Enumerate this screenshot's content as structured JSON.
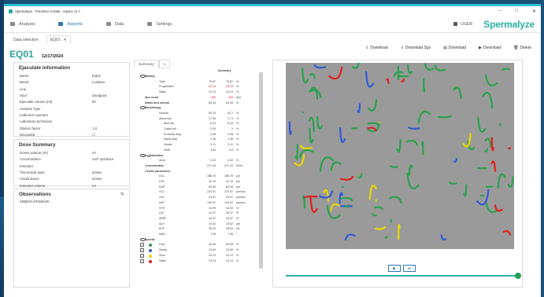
{
  "window": {
    "title": "Spermalyze - Precision Celular - equine v1.7",
    "min": "–",
    "max": "□",
    "close": "✕"
  },
  "nav": {
    "items": [
      {
        "label": "Analysis"
      },
      {
        "label": "Reports"
      },
      {
        "label": "Data"
      },
      {
        "label": "Settings"
      }
    ],
    "user": "USER",
    "brand": "Spermalyze"
  },
  "tabs": {
    "data_selection": "Data selection",
    "eq": "EQ01",
    "close": "✕"
  },
  "header": {
    "title": "EQ01",
    "date": "12/17/2024"
  },
  "actions": [
    {
      "label": "Download"
    },
    {
      "label": "Download Spz"
    },
    {
      "label": "Download"
    },
    {
      "label": "Download"
    },
    {
      "label": "Delete"
    }
  ],
  "ejaculate": {
    "title": "Ejaculate information",
    "rows": [
      {
        "k": "Name",
        "v": "EQ01"
      },
      {
        "k": "Breed",
        "v": "Lusitano"
      },
      {
        "k": "Line",
        "v": ""
      },
      {
        "k": "Stud",
        "v": "Zaragoza"
      },
      {
        "k": "Ejaculate volume (ml)",
        "v": "50"
      },
      {
        "k": "Analysis Type",
        "v": ""
      },
      {
        "k": "Collection operator",
        "v": ""
      },
      {
        "k": "Laboratory technician",
        "v": ""
      },
      {
        "k": "Dilution factor",
        "v": "1.8"
      },
      {
        "k": "Discarded",
        "v": "☐"
      }
    ]
  },
  "dose": {
    "title": "Dose Summary",
    "rows": [
      {
        "k": "Doses volume (ml)",
        "v": "ml"
      },
      {
        "k": "Concentration",
        "v": "x10⁶ spz/dose"
      },
      {
        "k": "Extender",
        "v": ""
      },
      {
        "k": "Theoretical dose",
        "v": "Doses"
      },
      {
        "k": "Actual doses",
        "v": "Doses"
      },
      {
        "k": "Extender volume",
        "v": "ml"
      }
    ]
  },
  "observations": {
    "title": "Observations",
    "text": "XIMEXX-STANDAR-"
  },
  "summary": {
    "tab1": "Summary",
    "tab2": "1",
    "col_summary": "Summary",
    "rows": [
      {
        "t": "sec",
        "l": "Motility"
      },
      {
        "t": "sub",
        "l": "Total",
        "a": "75.87",
        "b": "75.87",
        "u": "%"
      },
      {
        "t": "sub",
        "l": "Progressive",
        "a": "28.16",
        "b": "28.16",
        "u": "%",
        "red": true
      },
      {
        "t": "sub",
        "l": "Static",
        "a": "24.13",
        "b": "24.13",
        "u": "%"
      },
      {
        "t": "sec",
        "l": "Spz count",
        "a": "289",
        "b": "289",
        "u": "Spz",
        "red": true
      },
      {
        "t": "sec",
        "l": "Motile and normal",
        "a": "63.43",
        "b": "63.43",
        "u": "%"
      },
      {
        "t": "sec",
        "l": "Morphology"
      },
      {
        "t": "sub",
        "l": "Normal",
        "a": "82.70",
        "b": "82.7",
        "u": "%"
      },
      {
        "t": "sub",
        "l": "Abnormal",
        "a": "17.30",
        "b": "17.3",
        "u": "%"
      },
      {
        "t": "sub2",
        "l": "Bent tail",
        "a": "6.23",
        "b": "6.23",
        "u": "%"
      },
      {
        "t": "sub2",
        "l": "Coiled tail",
        "a": "0.00",
        "b": "0",
        "u": "%"
      },
      {
        "t": "sub2",
        "l": "Proximal drop",
        "a": "2.08",
        "b": "2.08",
        "u": "%"
      },
      {
        "t": "sub2",
        "l": "Distal drop",
        "a": "1.38",
        "b": "1.38",
        "u": "%"
      },
      {
        "t": "sub2",
        "l": "Heads",
        "a": "3.11",
        "b": "3.11",
        "u": "%"
      },
      {
        "t": "sub2",
        "l": "DMR",
        "a": "4.50",
        "b": "4.5",
        "u": "%"
      },
      {
        "t": "sec",
        "l": "Agglutination"
      },
      {
        "t": "sub",
        "l": "Area",
        "a": "0.42",
        "b": "0.42",
        "u": "%"
      },
      {
        "t": "sec",
        "l": "Concentration",
        "a": "271.44",
        "b": "271.44",
        "u": "M/ml"
      },
      {
        "t": "sec",
        "l": "Cinetic parameters"
      },
      {
        "t": "sub",
        "l": "DCL",
        "a": "186.78",
        "b": "186.78",
        "u": "µm"
      },
      {
        "t": "sub",
        "l": "DSL",
        "a": "42.19",
        "b": "42.19",
        "u": "µm"
      },
      {
        "t": "sub",
        "l": "DAP",
        "a": "83.05",
        "b": "83.05",
        "u": "µm"
      },
      {
        "t": "sub",
        "l": "VCL",
        "a": "223.41",
        "b": "223.41",
        "u": "µm/sec"
      },
      {
        "t": "sub",
        "l": "VSL",
        "a": "34.57",
        "b": "34.57",
        "u": "µm/sec"
      },
      {
        "t": "sub",
        "l": "VAP",
        "a": "100.02",
        "b": "100.02",
        "u": "µm/sec"
      },
      {
        "t": "sub",
        "l": "STR",
        "a": "34.99",
        "b": "34.99",
        "u": "%"
      },
      {
        "t": "sub",
        "l": "LIN",
        "a": "44.37",
        "b": "44.37",
        "u": "%"
      },
      {
        "t": "sub",
        "l": "WOB",
        "a": "44.37",
        "b": "44.37",
        "u": "%"
      },
      {
        "t": "sub",
        "l": "ALH",
        "a": "15.52",
        "b": "15.52",
        "u": "µm"
      },
      {
        "t": "sub",
        "l": "BCF",
        "a": "28.20",
        "b": "28.20",
        "u": "Hz"
      },
      {
        "t": "sub",
        "l": "MAD",
        "a": "7.96",
        "b": "7.96",
        "u": "°"
      },
      {
        "t": "sec",
        "l": "Speeds"
      },
      {
        "t": "sub",
        "l": "Fast",
        "a": "40.05",
        "b": "40.05",
        "u": "%"
      },
      {
        "t": "sub",
        "l": "Media",
        "a": "12.69",
        "b": "12.69",
        "u": "%"
      },
      {
        "t": "sub",
        "l": "Slow",
        "a": "23.13",
        "b": "23.13",
        "u": "%"
      },
      {
        "t": "sub",
        "l": "Static",
        "a": "24.13",
        "b": "24.13",
        "u": "%"
      }
    ]
  },
  "player": {
    "play": "▶",
    "step": "⏭"
  },
  "colors": {
    "accent": "#2aa39a",
    "fast": "#2aa14f",
    "media": "#2f5bd6",
    "slow": "#e8d800",
    "static": "#e02020"
  }
}
